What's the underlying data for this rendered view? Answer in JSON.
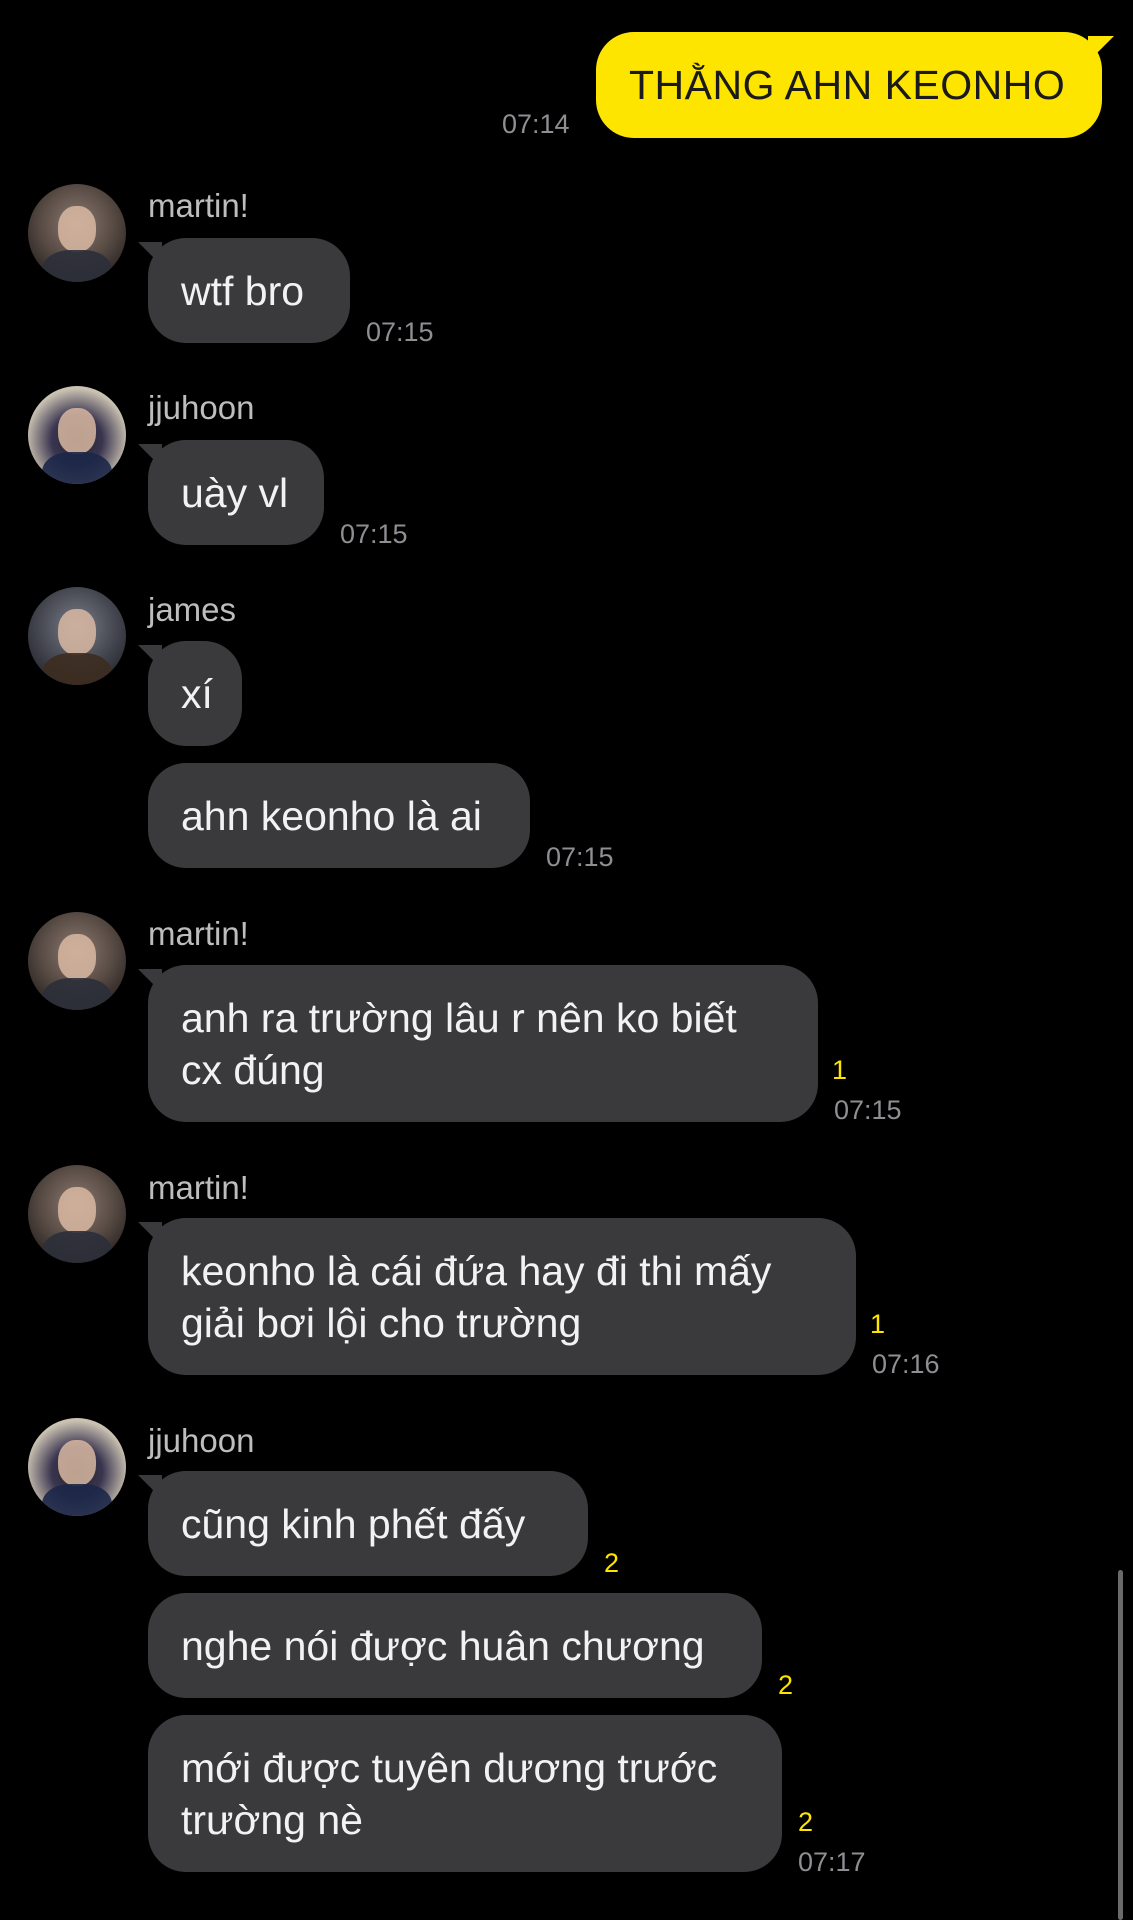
{
  "outgoing": {
    "text": "THẰNG AHN KEONHO",
    "time": "07:14"
  },
  "groups": [
    {
      "sender": "martin!",
      "avatar_icon": "martin-avatar-photo",
      "messages": [
        {
          "text": "wtf bro",
          "time": "07:15",
          "unread": ""
        }
      ]
    },
    {
      "sender": "jjuhoon",
      "avatar_icon": "jjuhoon-avatar-photo",
      "messages": [
        {
          "text": "uày vl",
          "time": "07:15",
          "unread": ""
        }
      ]
    },
    {
      "sender": "james",
      "avatar_icon": "james-avatar-photo",
      "messages": [
        {
          "text": "xí",
          "time": "",
          "unread": ""
        },
        {
          "text": "ahn keonho là ai",
          "time": "07:15",
          "unread": ""
        }
      ]
    },
    {
      "sender": "martin!",
      "avatar_icon": "martin-avatar-photo",
      "messages": [
        {
          "text": "anh ra trường lâu r nên ko biết cx đúng",
          "time": "07:15",
          "unread": "1"
        }
      ]
    },
    {
      "sender": "martin!",
      "avatar_icon": "martin-avatar-photo",
      "messages": [
        {
          "text": "keonho là cái đứa hay đi thi mấy giải bơi lội cho trường",
          "time": "07:16",
          "unread": "1"
        }
      ]
    },
    {
      "sender": "jjuhoon",
      "avatar_icon": "jjuhoon-avatar-photo",
      "messages": [
        {
          "text": "cũng kinh phết đấy",
          "time": "",
          "unread": "2"
        },
        {
          "text": "nghe nói được huân chương",
          "time": "",
          "unread": "2"
        },
        {
          "text": "mới được tuyên dương trước trường nè",
          "time": "07:17",
          "unread": "2"
        }
      ]
    }
  ],
  "colors": {
    "background": "#000000",
    "outgoing_bubble": "#fee500",
    "incoming_bubble": "#3a3a3c",
    "unread_count": "#fee500",
    "timestamp": "#8e8e93"
  }
}
